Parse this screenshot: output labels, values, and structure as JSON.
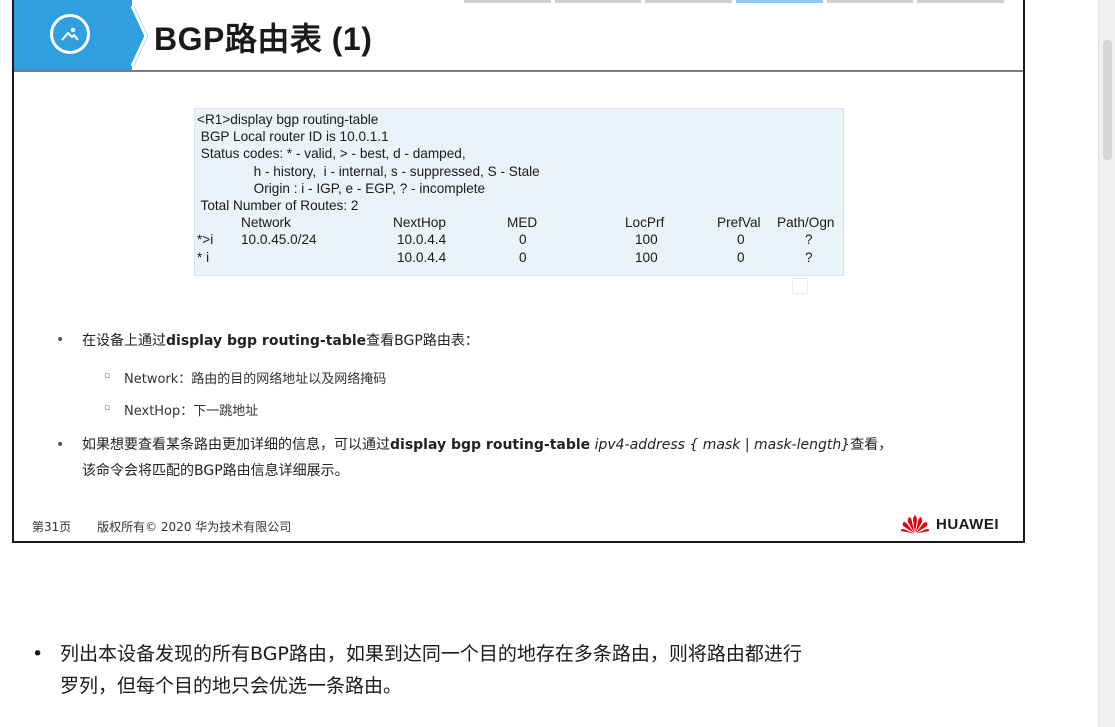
{
  "slide": {
    "title": "BGP路由表 (1)",
    "code": {
      "lines": [
        "<R1>display bgp routing-table",
        " BGP Local router ID is 10.0.1.1",
        " Status codes: * - valid, > - best, d - damped,",
        "               h - history,  i - internal, s - suppressed, S - Stale",
        "               Origin : i - IGP, e - EGP, ? - incomplete",
        " Total Number of Routes: 2"
      ],
      "headers": [
        "Network",
        "NextHop",
        "MED",
        "LocPrf",
        "PrefVal",
        "Path/Ogn"
      ],
      "rows": [
        {
          "flag": "*>i",
          "network": "10.0.45.0/24",
          "nexthop": "10.0.4.4",
          "med": "0",
          "locprf": "100",
          "prefval": "0",
          "path": "?"
        },
        {
          "flag": "* i",
          "network": "",
          "nexthop": "10.0.4.4",
          "med": "0",
          "locprf": "100",
          "prefval": "0",
          "path": "?"
        }
      ]
    },
    "bullets": {
      "b1_prefix": "在设备上通过",
      "b1_cmd": "display  bgp  routing-table",
      "b1_suffix": "查看BGP路由表：",
      "sub1": "Network：路由的目的网络地址以及网络掩码",
      "sub2": "NextHop：下一跳地址",
      "b2_prefix": "如果想要查看某条路由更加详细的信息，可以通过",
      "b2_cmd": "display bgp routing-table",
      "b2_italic": "ipv4-address { mask | mask-length}",
      "b2_suffix": "查看，",
      "b2_line2": "该命令会将匹配的BGP路由信息详细展示。"
    },
    "footer": {
      "page": "第31页",
      "copyright": "版权所有© 2020 华为技术有限公司",
      "brand": "HUAWEI"
    },
    "colors": {
      "accent": "#2f9fe0",
      "code_bg": "#e9f3f8",
      "brand_red": "#e60012"
    }
  },
  "notes": {
    "line1": "列出本设备发现的所有BGP路由，如果到达同一个目的地存在多条路由，则将路由都进行",
    "line2": "罗列，但每个目的地只会优选一条路由。"
  }
}
